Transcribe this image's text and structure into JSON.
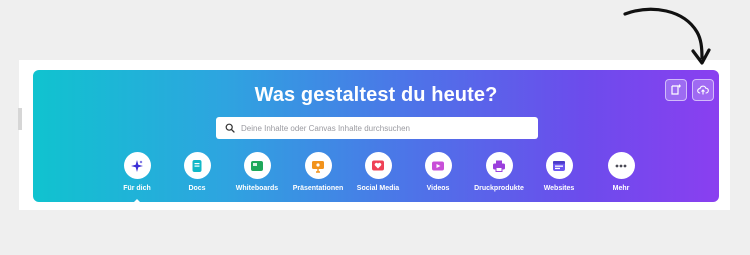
{
  "hero": {
    "headline": "Was gestaltest du heute?",
    "search_placeholder": "Deine Inhalte oder Canvas Inhalte durchsuchen",
    "search_icon": "search-icon",
    "top_buttons": [
      {
        "icon": "new-design-icon"
      },
      {
        "icon": "upload-cloud-icon"
      }
    ]
  },
  "nav": {
    "items": [
      {
        "label": "Für dich",
        "icon": "sparkle-icon",
        "color": "#3b2fd6",
        "active": true
      },
      {
        "label": "Docs",
        "icon": "doc-icon",
        "color": "#10b8c8",
        "active": false
      },
      {
        "label": "Whiteboards",
        "icon": "whiteboard-icon",
        "color": "#1fa85b",
        "active": false
      },
      {
        "label": "Präsentationen",
        "icon": "presentation-icon",
        "color": "#f2931c",
        "active": false
      },
      {
        "label": "Social Media",
        "icon": "heart-icon",
        "color": "#ef4155",
        "active": false
      },
      {
        "label": "Videos",
        "icon": "video-icon",
        "color": "#c84fd8",
        "active": false
      },
      {
        "label": "Druckprodukte",
        "icon": "print-icon",
        "color": "#9b3fdc",
        "active": false
      },
      {
        "label": "Websites",
        "icon": "website-icon",
        "color": "#6b55f0",
        "active": false
      },
      {
        "label": "Mehr",
        "icon": "more-icon",
        "color": "#4a4a55",
        "active": false
      }
    ]
  },
  "colors": {
    "gradient_start": "#10c3cf",
    "gradient_end": "#8a3ff0",
    "annotation_arrow": "#111111"
  }
}
